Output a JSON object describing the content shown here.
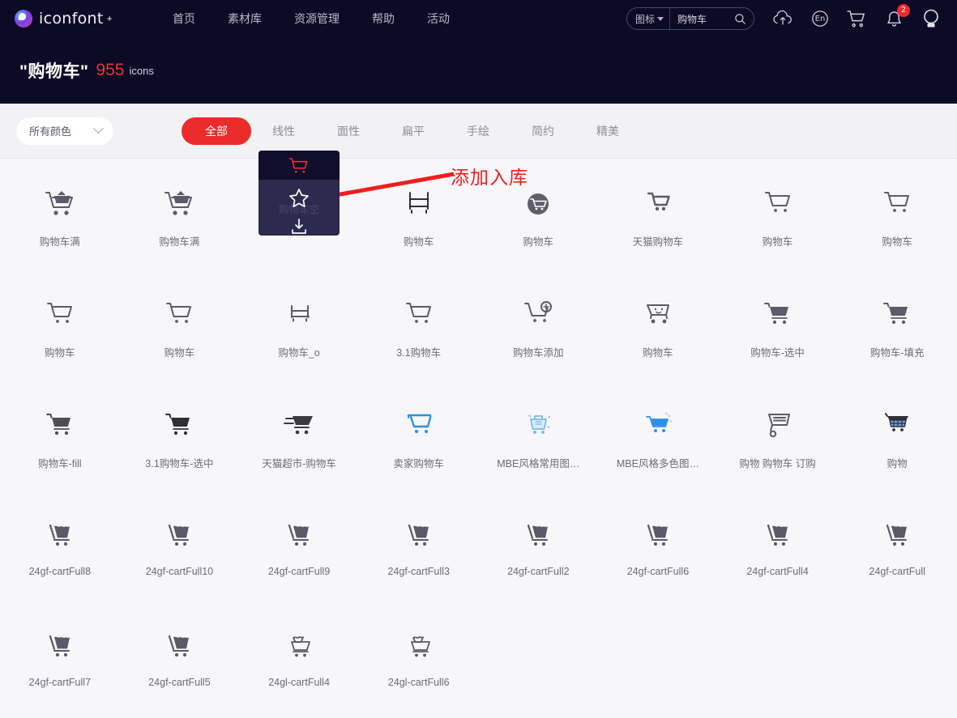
{
  "header": {
    "logo_text": "iconfont",
    "logo_plus": "+",
    "nav": [
      {
        "label": "首页"
      },
      {
        "label": "素材库"
      },
      {
        "label": "资源管理"
      },
      {
        "label": "帮助"
      },
      {
        "label": "活动"
      }
    ],
    "search": {
      "category": "图标",
      "value": "购物车",
      "placeholder": "购物车",
      "search_icon": "search-icon",
      "chevron_icon": "chevron-down-icon"
    },
    "tools": [
      {
        "name": "upload-cloud-icon",
        "label": ""
      },
      {
        "name": "language-en-icon",
        "label": "En"
      },
      {
        "name": "cart-icon",
        "label": ""
      },
      {
        "name": "bell-icon",
        "label": "",
        "badge": "2"
      },
      {
        "name": "avatar-icon",
        "label": ""
      }
    ],
    "notification_count": "2",
    "background_color": "#0d0a26"
  },
  "title_band": {
    "query": "\"购物车\"",
    "count": "955",
    "unit": "icons",
    "count_color": "#e8352c"
  },
  "filter_bar": {
    "color_select": {
      "label": "所有颜色",
      "chevron_icon": "chevron-down-icon"
    },
    "tabs": [
      {
        "label": "全部",
        "active": true
      },
      {
        "label": "线性",
        "active": false
      },
      {
        "label": "面性",
        "active": false
      },
      {
        "label": "扁平",
        "active": false
      },
      {
        "label": "手绘",
        "active": false
      },
      {
        "label": "简约",
        "active": false
      },
      {
        "label": "精美",
        "active": false
      }
    ],
    "active_color": "#ec2b2b"
  },
  "annotation": {
    "text": "添加入库",
    "color": "#f01e1e",
    "arrow": "red-arrow-pointing-left-down"
  },
  "hover_card": {
    "label": "购物车空",
    "cart_icon": "cart-icon",
    "star_icon": "star-icon",
    "download_icon": "download-icon",
    "cart_color": "#ff2d2d",
    "bg_color": "#2c2a4e"
  },
  "icons": [
    {
      "label": "购物车满",
      "style": "cart-full-solid",
      "color": "#5b5b6b"
    },
    {
      "label": "购物车满",
      "style": "cart-full-solid",
      "color": "#5b5b6b"
    },
    {
      "label": "购物车空",
      "style": "cart-outline-hover",
      "color": "#ff2d2d"
    },
    {
      "label": "购物车",
      "style": "cart-flatbed",
      "color": "#2f2f38"
    },
    {
      "label": "购物车",
      "style": "cart-circle-filled",
      "color": "#5f5f6b"
    },
    {
      "label": "天猫购物车",
      "style": "cart-tmall",
      "color": "#5b5b6b"
    },
    {
      "label": "购物车",
      "style": "cart-outline",
      "color": "#5b5b6b"
    },
    {
      "label": "购物车",
      "style": "cart-outline",
      "color": "#5b5b6b"
    },
    {
      "label": "购物车",
      "style": "cart-outline",
      "color": "#5b5b6b"
    },
    {
      "label": "购物车",
      "style": "cart-outline-thin",
      "color": "#5b5b6b"
    },
    {
      "label": "购物车_o",
      "style": "cart-flatbed-thin",
      "color": "#5b5b6b"
    },
    {
      "label": "3.1购物车",
      "style": "cart-outline",
      "color": "#5b5b6b"
    },
    {
      "label": "购物车添加",
      "style": "cart-plus",
      "color": "#5b5b6b"
    },
    {
      "label": "购物车",
      "style": "cart-smile",
      "color": "#5b5b6b"
    },
    {
      "label": "购物车-选中",
      "style": "cart-solid",
      "color": "#5b5b6b"
    },
    {
      "label": "购物车-填充",
      "style": "cart-solid",
      "color": "#5b5b6b"
    },
    {
      "label": "购物车-fill",
      "style": "cart-solid",
      "color": "#4d4d58"
    },
    {
      "label": "3.1购物车-选中",
      "style": "cart-solid",
      "color": "#2f2f38"
    },
    {
      "label": "天猫超市-购物车",
      "style": "cart-speed",
      "color": "#3a3a44"
    },
    {
      "label": "卖家购物车",
      "style": "cart-outline-blue",
      "color": "#2f8fe8"
    },
    {
      "label": "MBE风格常用图…",
      "style": "cart-mbe-mono",
      "color": "#7fb8e8"
    },
    {
      "label": "MBE风格多色图…",
      "style": "cart-mbe-color",
      "color": "#2f8fe8"
    },
    {
      "label": "购物 购物车 订购",
      "style": "cart-lines",
      "color": "#5b5b6b"
    },
    {
      "label": "购物",
      "style": "cart-grid-blue",
      "color": "#2f2f38"
    },
    {
      "label": "24gf-cartFull8",
      "style": "cart-full-blob",
      "color": "#5a5a68"
    },
    {
      "label": "24gf-cartFull10",
      "style": "cart-full-blob",
      "color": "#5a5a68"
    },
    {
      "label": "24gf-cartFull9",
      "style": "cart-full-blob",
      "color": "#5a5a68"
    },
    {
      "label": "24gf-cartFull3",
      "style": "cart-full-blob",
      "color": "#5a5a68"
    },
    {
      "label": "24gf-cartFull2",
      "style": "cart-full-blob",
      "color": "#5a5a68"
    },
    {
      "label": "24gf-cartFull6",
      "style": "cart-full-blob",
      "color": "#5a5a68"
    },
    {
      "label": "24gf-cartFull4",
      "style": "cart-full-blob",
      "color": "#5a5a68"
    },
    {
      "label": "24gf-cartFull",
      "style": "cart-full-blob",
      "color": "#5a5a68"
    },
    {
      "label": "24gf-cartFull7",
      "style": "cart-full-blob",
      "color": "#5a5a68"
    },
    {
      "label": "24gf-cartFull5",
      "style": "cart-full-blob",
      "color": "#5a5a68"
    },
    {
      "label": "24gl-cartFull4",
      "style": "cart-full-outline",
      "color": "#5a5a68"
    },
    {
      "label": "24gl-cartFull6",
      "style": "cart-full-outline",
      "color": "#5a5a68"
    }
  ]
}
